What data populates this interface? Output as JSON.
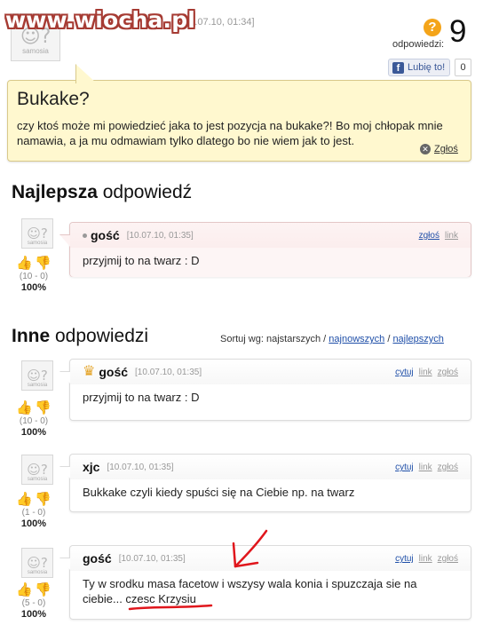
{
  "watermark": "www.wiocha.pl",
  "question": {
    "author_fragment": "n",
    "date": "[10.07.10, 01:34]",
    "answers_label": "odpowiedzi:",
    "answers_count": "9",
    "fb_like_label": "Lubię to!",
    "fb_like_count": "0",
    "title": "Bukake?",
    "body": "czy ktoś może mi powiedzieć jaka to jest pozycja na bukake?! Bo moj chłopak mnie namawia, a ja mu odmawiam tylko dlatego bo nie wiem jak to jest.",
    "report_label": "Zgłoś"
  },
  "avatar_word": "samosia",
  "best": {
    "heading_bold": "Najlepsza",
    "heading_rest": " odpowiedź",
    "answer": {
      "author": "gość",
      "date": "[10.07.10, 01:35]",
      "actions": [
        "zgłoś",
        "link"
      ],
      "text": "przyjmij to na twarz : D",
      "votes": "(10 - 0)",
      "percent": "100%"
    }
  },
  "others": {
    "heading_bold": "Inne",
    "heading_rest": " odpowiedzi",
    "sort_label": "Sortuj wg: najstarszych / ",
    "sort_newest": "najnowszych",
    "sort_sep": " / ",
    "sort_best": "najlepszych",
    "answers": [
      {
        "author": "gość",
        "date": "[10.07.10, 01:35]",
        "actions": [
          "cytuj",
          "link",
          "zgłoś"
        ],
        "text": "przyjmij to na twarz : D",
        "votes": "(10 - 0)",
        "percent": "100%"
      },
      {
        "author": "xjc",
        "date": "[10.07.10, 01:35]",
        "actions": [
          "cytuj",
          "link",
          "zgłoś"
        ],
        "text": "Bukkake czyli kiedy spuści się na Ciebie np. na twarz",
        "votes": "(1 - 0)",
        "percent": "100%"
      },
      {
        "author": "gość",
        "date": "[10.07.10, 01:35]",
        "actions": [
          "cytuj",
          "link",
          "zgłoś"
        ],
        "text": "Ty w srodku masa facetow i wszysy wala konia i spuzczaja sie na ciebie... czesc Krzysiu",
        "votes": "(5 - 0)",
        "percent": "100%"
      }
    ]
  },
  "colors": {
    "question_bg": "#fff8cf",
    "link_blue": "#1f4fa8",
    "thumb_up": "#c23a8c",
    "thumb_down": "#e0a526",
    "annotation_red": "#e0161c"
  },
  "icons": {
    "answers": "question-mark-icon",
    "facebook": "facebook-icon",
    "report": "close-circle-icon",
    "thumb_up": "thumb-up-icon",
    "thumb_down": "thumb-down-icon",
    "crown": "crown-icon"
  }
}
